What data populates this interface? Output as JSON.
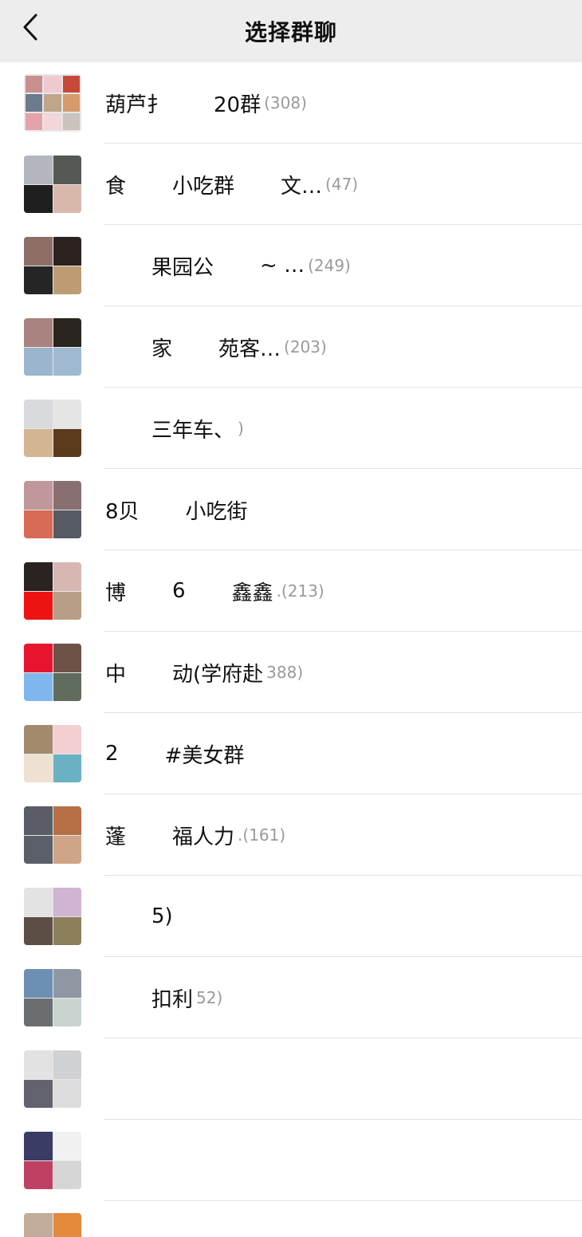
{
  "header": {
    "title": "选择群聊",
    "back_icon": "chevron-left-icon"
  },
  "groups": [
    {
      "name": "葫芦扌",
      "name2": "20群",
      "count": "(308)",
      "avatar": {
        "layout": "nine",
        "colors": [
          "#c98e8e",
          "#f0c9d0",
          "#c7493a",
          "#6b7b8c",
          "#bfa58a",
          "#d79b6a",
          "#e4a2a9",
          "#f2d6da",
          "#c9c2bd"
        ]
      }
    },
    {
      "name": "食",
      "name2": "小吃群",
      "name3": "文…",
      "count": "(47)",
      "avatar": {
        "layout": "four",
        "colors": [
          "#b3b6bd",
          "#555955",
          "#1f1f1f",
          "#d9b8ac"
        ]
      }
    },
    {
      "name": "",
      "name2": "果园公",
      "name3": "~ …",
      "count": "(249)",
      "avatar": {
        "layout": "four",
        "colors": [
          "#8e6f68",
          "#2c2321",
          "#252525",
          "#bd9c74"
        ]
      }
    },
    {
      "name": "",
      "name2": "家",
      "name3": "苑客…",
      "count": "(203)",
      "avatar": {
        "layout": "four",
        "colors": [
          "#a88380",
          "#2b2520",
          "#9bb5ce",
          "#9fbad0"
        ]
      }
    },
    {
      "name": "",
      "name2": "三年车、",
      "name3": "",
      "count": ")",
      "avatar": {
        "layout": "four",
        "colors": [
          "#d8dadd",
          "#e5e5e5",
          "#d4b591",
          "#5b3a1e"
        ]
      }
    },
    {
      "name": "8贝",
      "name2": "小吃街",
      "name3": "",
      "count": "",
      "avatar": {
        "layout": "four",
        "colors": [
          "#c0989b",
          "#8a6f72",
          "#d96a55",
          "#555a63"
        ]
      }
    },
    {
      "name": "博",
      "name2": "6",
      "name3": "鑫鑫",
      "count": ".(213)",
      "avatar": {
        "layout": "four",
        "colors": [
          "#2a2320",
          "#d8b7b2",
          "#ee1313",
          "#b99e86"
        ]
      }
    },
    {
      "name": "中",
      "name2": "动(学府赴",
      "name3": "",
      "count": "388)",
      "avatar": {
        "layout": "four",
        "colors": [
          "#e8152e",
          "#6e5148",
          "#7fb6ee",
          "#606c5c"
        ]
      }
    },
    {
      "name": "2",
      "name2": "#美女群",
      "name3": "",
      "count": "",
      "avatar": {
        "layout": "four",
        "colors": [
          "#a38a6d",
          "#f4cfd2",
          "#efe1d2",
          "#6bb1c4"
        ]
      }
    },
    {
      "name": "蓬",
      "name2": "福人力",
      "name3": "",
      "count": ".(161)",
      "avatar": {
        "layout": "four",
        "colors": [
          "#5a5d66",
          "#b76f46",
          "#5b5f68",
          "#d0a486"
        ]
      }
    },
    {
      "name": "",
      "name2": "5)",
      "name3": "",
      "count": "",
      "avatar": {
        "layout": "four",
        "colors": [
          "#e3e3e3",
          "#d1b3d3",
          "#5d4e45",
          "#8b7f5c"
        ]
      }
    },
    {
      "name": "",
      "name2": "扣利",
      "name3": "",
      "count": "52)",
      "avatar": {
        "layout": "four",
        "colors": [
          "#6c8fb3",
          "#8f97a3",
          "#6b6e70",
          "#c9d4d0"
        ]
      }
    },
    {
      "name": "",
      "name2": "",
      "name3": "",
      "count": "",
      "avatar": {
        "layout": "four",
        "colors": [
          "#e2e2e2",
          "#cfd2d4",
          "#63636e",
          "#dcdcdc"
        ]
      }
    },
    {
      "name": "",
      "name2": "",
      "name3": "",
      "count": "",
      "avatar": {
        "layout": "four",
        "colors": [
          "#3a3c66",
          "#f1f1f1",
          "#c04064",
          "#d6d6d6"
        ]
      }
    },
    {
      "name": "",
      "name2": "",
      "name3": "",
      "count": "",
      "avatar": {
        "layout": "four",
        "colors": [
          "#c2ad9a",
          "#e28a3a",
          "#e5e5e5",
          "#e5e5e5"
        ]
      }
    }
  ]
}
